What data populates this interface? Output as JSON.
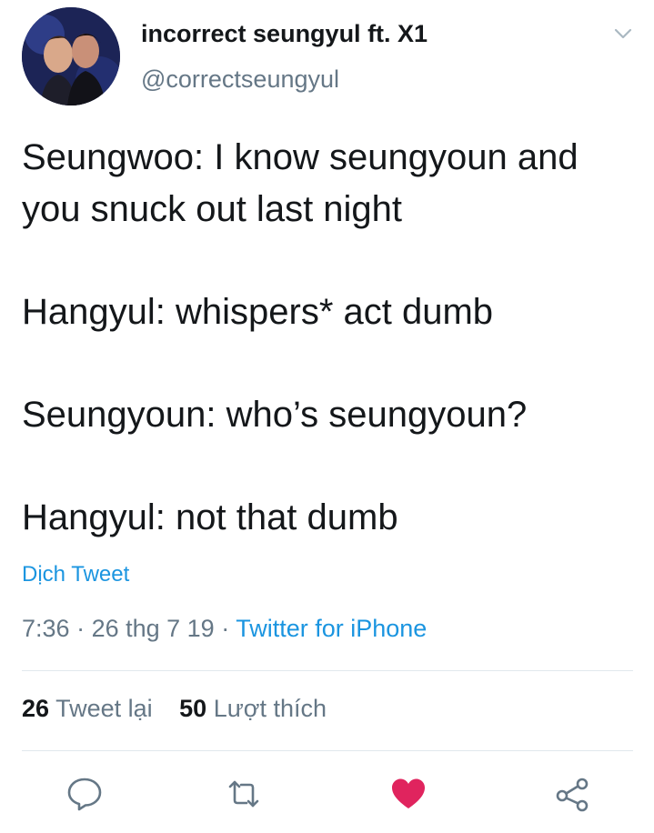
{
  "header": {
    "display_name": "incorrect seungyul ft. X1",
    "handle": "@correctseungyul"
  },
  "tweet": {
    "paragraphs": [
      [
        "Seungwoo: I know seungyoun and",
        "you snuck out last night"
      ],
      [
        "Hangyul: whispers* act dumb"
      ],
      [
        "Seungyoun: who’s seungyoun?"
      ],
      [
        "Hangyul: not that dumb"
      ]
    ],
    "translate_label": "Dịch Tweet",
    "time": "7:36",
    "separator": " · ",
    "date": "26 thg 7 19",
    "source": "Twitter for iPhone"
  },
  "stats": {
    "retweets_count": "26",
    "retweets_label": "Tweet lại",
    "likes_count": "50",
    "likes_label": "Lượt thích"
  },
  "icons": {
    "reply": "reply-icon",
    "retweet": "retweet-icon",
    "like": "heart-icon",
    "share": "share-icon",
    "more": "chevron-down-icon"
  },
  "colors": {
    "link": "#1b95e0",
    "muted": "#657786",
    "like": "#e0245e"
  }
}
